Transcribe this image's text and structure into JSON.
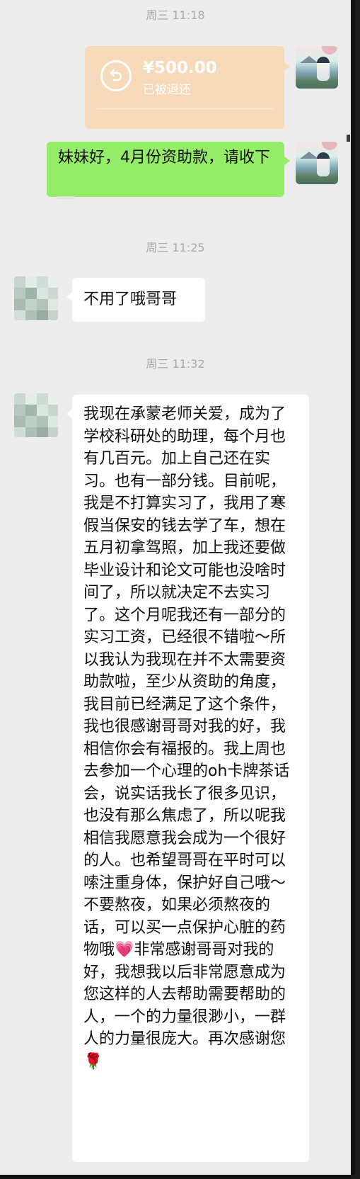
{
  "chat": {
    "messages": [
      {
        "time": "周三 11:18",
        "transfer_amount": "¥500.00",
        "transfer_status": "已被退还"
      },
      {
        "text": "妹妹好，4月份资助款，请收下"
      },
      {
        "time": "周三 11:25",
        "text": "不用了哦哥哥"
      },
      {
        "time": "周三 11:32",
        "text": "我现在承蒙老师关爱，成为了学校科研处的助理，每个月也有几百元。加上自己还在实习。也有一部分钱。目前呢，我是不打算实习了，我用了寒假当保安的钱去学了车，想在五月初拿驾照，加上我还要做毕业设计和论文可能也没啥时间了，所以就决定不去实习了。这个月呢我还有一部分的实习工资，已经很不错啦～所以我认为我现在并不太需要资助款啦，至少从资助的角度，我目前已经满足了这个条件，我也很感谢哥哥对我的好，我相信你会有福报的。我上周也去参加一个心理的oh卡牌茶话会，说实话我长了很多见识，也没有那么焦虑了，所以呢我相信我愿意我会成为一个很好的人。也希望哥哥在平时可以嗦注重身体，保护好自己哦～不要熬夜，如果必须熬夜的话，可以买一点保护心脏的药物哦💗非常感谢哥哥对我的好，我想我以后非常愿意成为您这样的人去帮助需要帮助的人，一个的力量很渺小，一群人的力量很庞大。再次感谢您🌹"
      }
    ],
    "colors": {
      "background": "#ededed",
      "sent_bubble": "#95ec69",
      "received_bubble": "#ffffff",
      "transfer_returned": "#f8d9b8",
      "timestamp": "#a9a9a9"
    }
  }
}
